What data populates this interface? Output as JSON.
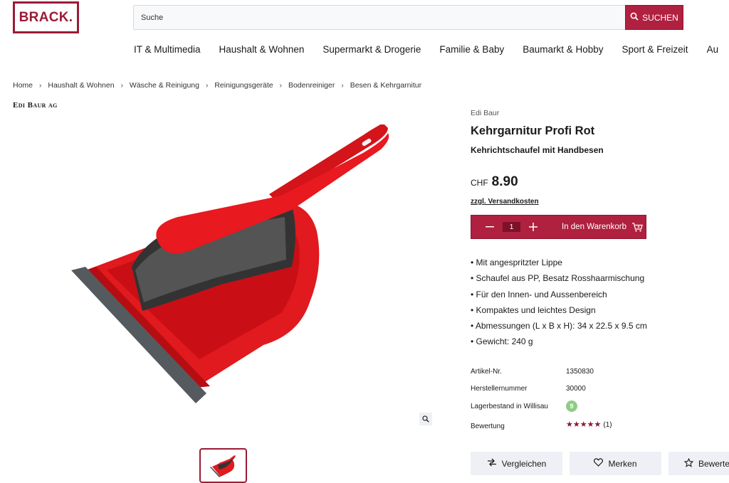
{
  "header": {
    "logo_text": "BRACK.",
    "search_placeholder": "Suche",
    "search_button_label": "SUCHEN"
  },
  "nav": {
    "items": [
      "IT & Multimedia",
      "Haushalt & Wohnen",
      "Supermarkt & Drogerie",
      "Familie & Baby",
      "Baumarkt & Hobby",
      "Sport & Freizeit",
      "Au"
    ]
  },
  "breadcrumb": [
    "Home",
    "Haushalt & Wohnen",
    "Wäsche & Reinigung",
    "Reinigungsgeräte",
    "Bodenreiniger",
    "Besen & Kehrgarnitur"
  ],
  "vendor_logo_text": "Edi Baur ag",
  "product": {
    "brand": "Edi Baur",
    "title": "Kehrgarnitur Profi Rot",
    "subtitle": "Kehrichtschaufel mit Handbesen",
    "currency": "CHF",
    "price": "8.90",
    "shipping_link": "zzgl. Versandkosten",
    "quantity": "1",
    "add_to_cart_label": "In den Warenkorb",
    "features": [
      "Mit angespritzter Lippe",
      "Schaufel aus PP, Besatz Rosshaarmischung",
      "Für den Innen- und Aussenbereich",
      "Kompaktes und leichtes Design",
      "Abmessungen (L x B x H): 34 x 22.5 x 9.5 cm",
      "Gewicht: 240 g"
    ],
    "specs": {
      "article_label": "Artikel-Nr.",
      "article_value": "1350830",
      "manufacturer_label": "Herstellernummer",
      "manufacturer_value": "30000",
      "stock_label": "Lagerbestand in Willisau",
      "stock_value": "9",
      "rating_label": "Bewertung",
      "rating_stars": 5,
      "rating_count": "(1)"
    }
  },
  "actions": {
    "compare_label": "Vergleichen",
    "save_label": "Merken",
    "rate_label": "Bewerten"
  },
  "colors": {
    "brand": "#9b1b36",
    "button": "#b0203f",
    "stock_badge": "#8dcd84"
  }
}
